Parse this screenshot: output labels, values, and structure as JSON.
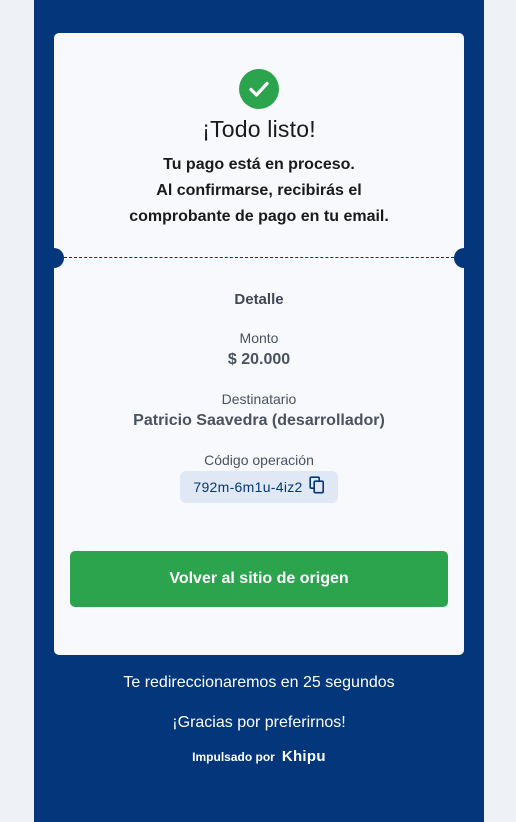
{
  "colors": {
    "brand_navy": "#03367a",
    "success_green": "#2ca44e",
    "card_bg": "#f7f9fc",
    "code_bg": "#dfe8f4"
  },
  "status": {
    "icon": "check-circle-icon",
    "title": "¡Todo listo!",
    "message_lines": [
      "Tu pago está en proceso.",
      "Al confirmarse, recibirás el",
      "comprobante de pago en tu email."
    ]
  },
  "detail": {
    "heading": "Detalle",
    "amount_label": "Monto",
    "amount_value": "$ 20.000",
    "recipient_label": "Destinatario",
    "recipient_value": "Patricio Saavedra (desarrollador)",
    "operation_code_label": "Código operación",
    "operation_code_value": "792m-6m1u-4iz2",
    "copy_icon": "copy-icon"
  },
  "actions": {
    "return_button_label": "Volver al sitio de origen"
  },
  "footer": {
    "redirect_text": "Te redireccionaremos en 25 segundos",
    "thanks_text": "¡Gracias por preferirnos!",
    "powered_by_label": "Impulsado por",
    "brand_name": "Khipu"
  }
}
